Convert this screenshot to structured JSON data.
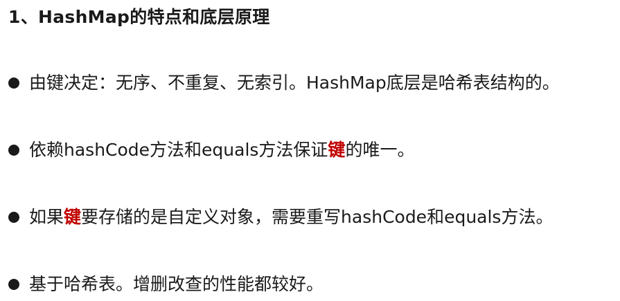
{
  "heading": "1、HashMap的特点和底层原理",
  "bullets": [
    {
      "text": "由键决定：无序、不重复、无索引。HashMap底层是哈希表结构的。"
    },
    {
      "pre": "依赖hashCode方法和equals方法保证",
      "highlight": "键",
      "post": "的唯一。"
    },
    {
      "pre": "如果",
      "highlight": "键",
      "post": "要存储的是自定义对象，需要重写hashCode和equals方法。"
    },
    {
      "text": "基于哈希表。增删改查的性能都较好。"
    }
  ],
  "colors": {
    "text": "#1a1a1a",
    "highlight": "#c00000",
    "background": "#ffffff"
  }
}
